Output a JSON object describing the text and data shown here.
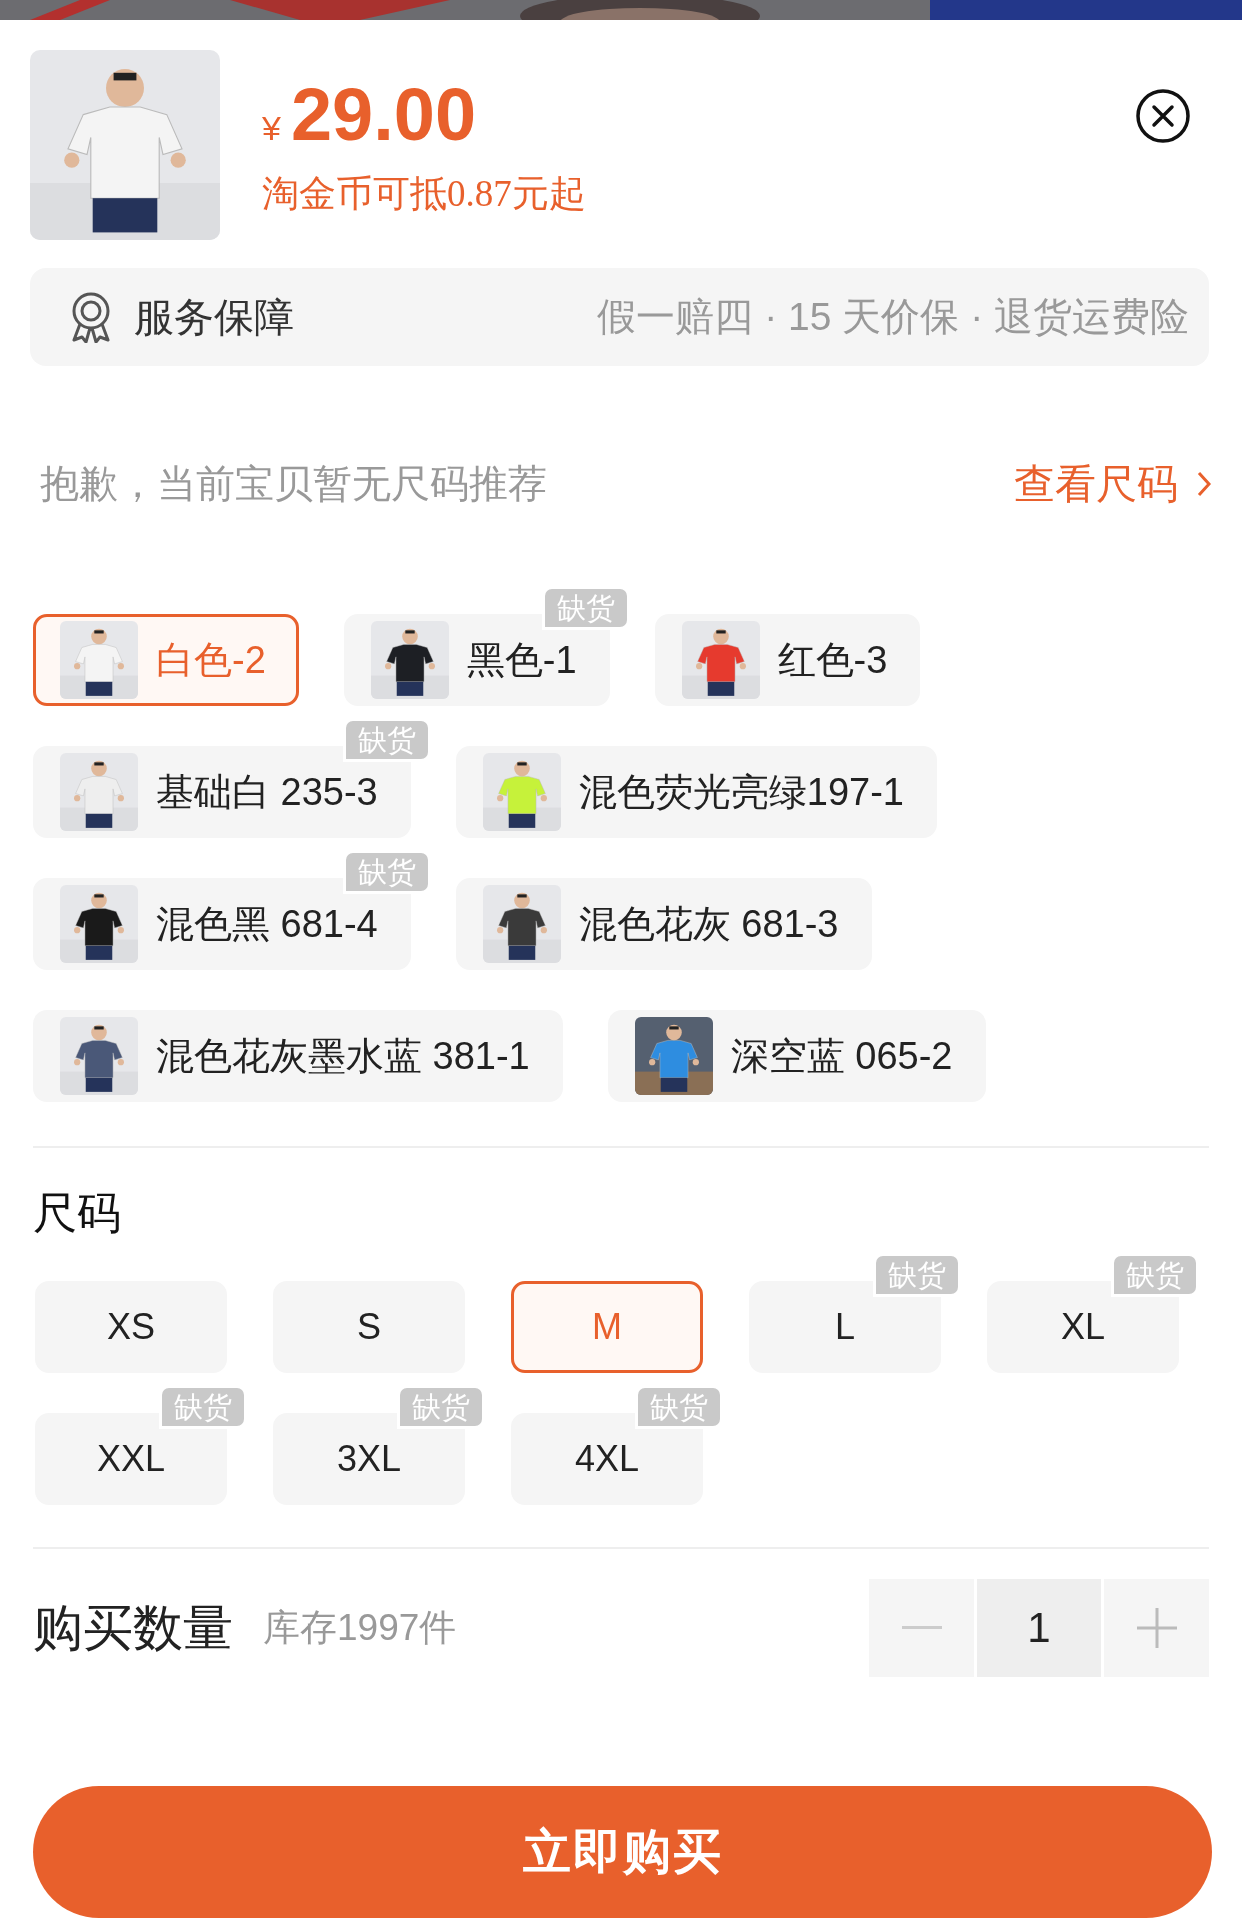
{
  "product": {
    "currency": "¥",
    "price": "29.00",
    "coin_note": "淘金币可抵0.87元起"
  },
  "service": {
    "label": "服务保障",
    "details": "假一赔四 · 15 天价保 · 退货运费险"
  },
  "size_tip": {
    "text": "抱歉，当前宝贝暂无尺码推荐",
    "link": "查看尺码"
  },
  "colors": [
    {
      "label": "白色-2",
      "selected": true
    },
    {
      "label": "黑色-1",
      "selected": false,
      "badge": "缺货"
    },
    {
      "label": "红色-3",
      "selected": false
    },
    {
      "label": "基础白 235-3",
      "selected": false,
      "badge": "缺货"
    },
    {
      "label": "混色荧光亮绿197-1",
      "selected": false
    },
    {
      "label": "混色黑 681-4",
      "selected": false,
      "badge": "缺货"
    },
    {
      "label": "混色花灰 681-3",
      "selected": false
    },
    {
      "label": "混色花灰墨水蓝 381-1",
      "selected": false
    },
    {
      "label": "深空蓝 065-2",
      "selected": false
    }
  ],
  "size_section": {
    "title": "尺码",
    "sizes": [
      {
        "label": "XS",
        "selected": false
      },
      {
        "label": "S",
        "selected": false
      },
      {
        "label": "M",
        "selected": true
      },
      {
        "label": "L",
        "selected": false,
        "badge": "缺货"
      },
      {
        "label": "XL",
        "selected": false,
        "badge": "缺货"
      },
      {
        "label": "XXL",
        "selected": false,
        "badge": "缺货"
      },
      {
        "label": "3XL",
        "selected": false,
        "badge": "缺货"
      },
      {
        "label": "4XL",
        "selected": false,
        "badge": "缺货"
      }
    ]
  },
  "quantity": {
    "label": "购买数量",
    "stock": "库存1997件",
    "value": "1"
  },
  "buy_button": "立即购买"
}
